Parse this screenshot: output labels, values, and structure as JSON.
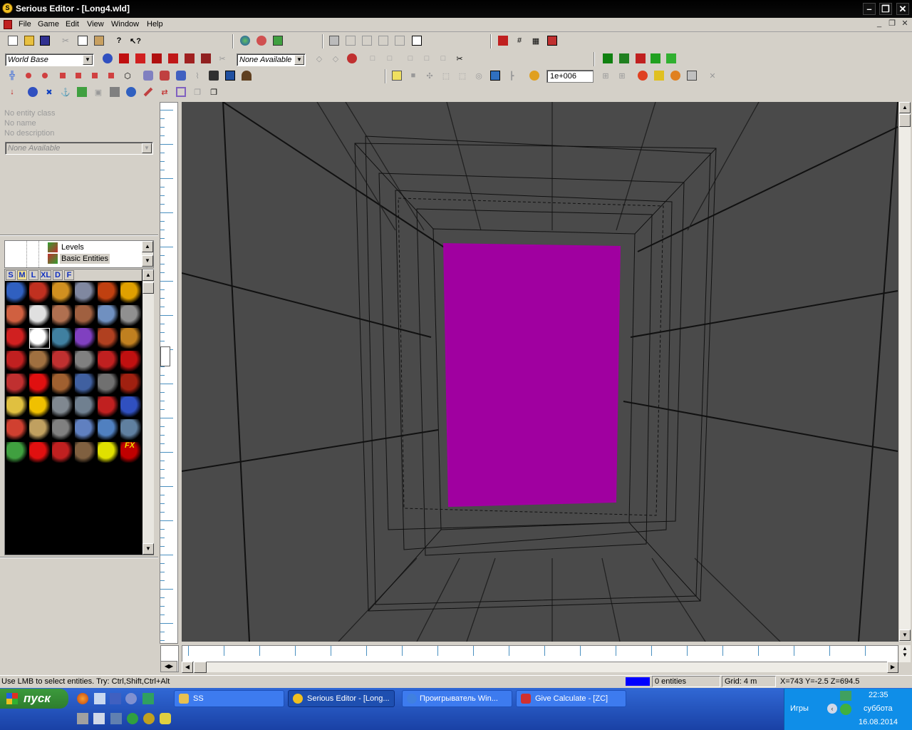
{
  "window": {
    "title": "Serious Editor - [Long4.wld]",
    "icon_letter": "S"
  },
  "menu": [
    {
      "label": "File"
    },
    {
      "label": "Game"
    },
    {
      "label": "Edit"
    },
    {
      "label": "View"
    },
    {
      "label": "Window"
    },
    {
      "label": "Help"
    }
  ],
  "toolbar": {
    "world_base_combo": "World Base",
    "none_available_combo": "None Available",
    "grid_value": "1e+006"
  },
  "entity_info": {
    "class": "No entity class",
    "name": "No name",
    "description": "No description",
    "combo": "None Available"
  },
  "tree": {
    "items": [
      {
        "label": "Levels"
      },
      {
        "label": "Basic Entities"
      }
    ]
  },
  "palette": {
    "size_tabs": [
      "S",
      "M",
      "L",
      "XL",
      "D",
      "F"
    ],
    "fx_label": "FX"
  },
  "status": {
    "hint": "Use LMB to select entities. Try: Ctrl,Shift,Ctrl+Alt",
    "entities": "0 entities",
    "grid": "Grid: 4 m",
    "coords": "X=743 Y=-2.5 Z=694.5",
    "color_swatch": "#0000ff"
  },
  "taskbar": {
    "start_label": "пуск",
    "tasks": [
      {
        "label": "SS"
      },
      {
        "label": "Serious Editor - [Long..."
      },
      {
        "label": "Проигрыватель Win..."
      },
      {
        "label": "Give Calculate - [ZC]"
      }
    ],
    "tray_label": "Игры",
    "clock": "22:35",
    "weekday": "суббота",
    "date": "16.08.2014"
  },
  "colors": {
    "portal": "#a000a0",
    "viewport_bg": "#4a4a4a"
  }
}
